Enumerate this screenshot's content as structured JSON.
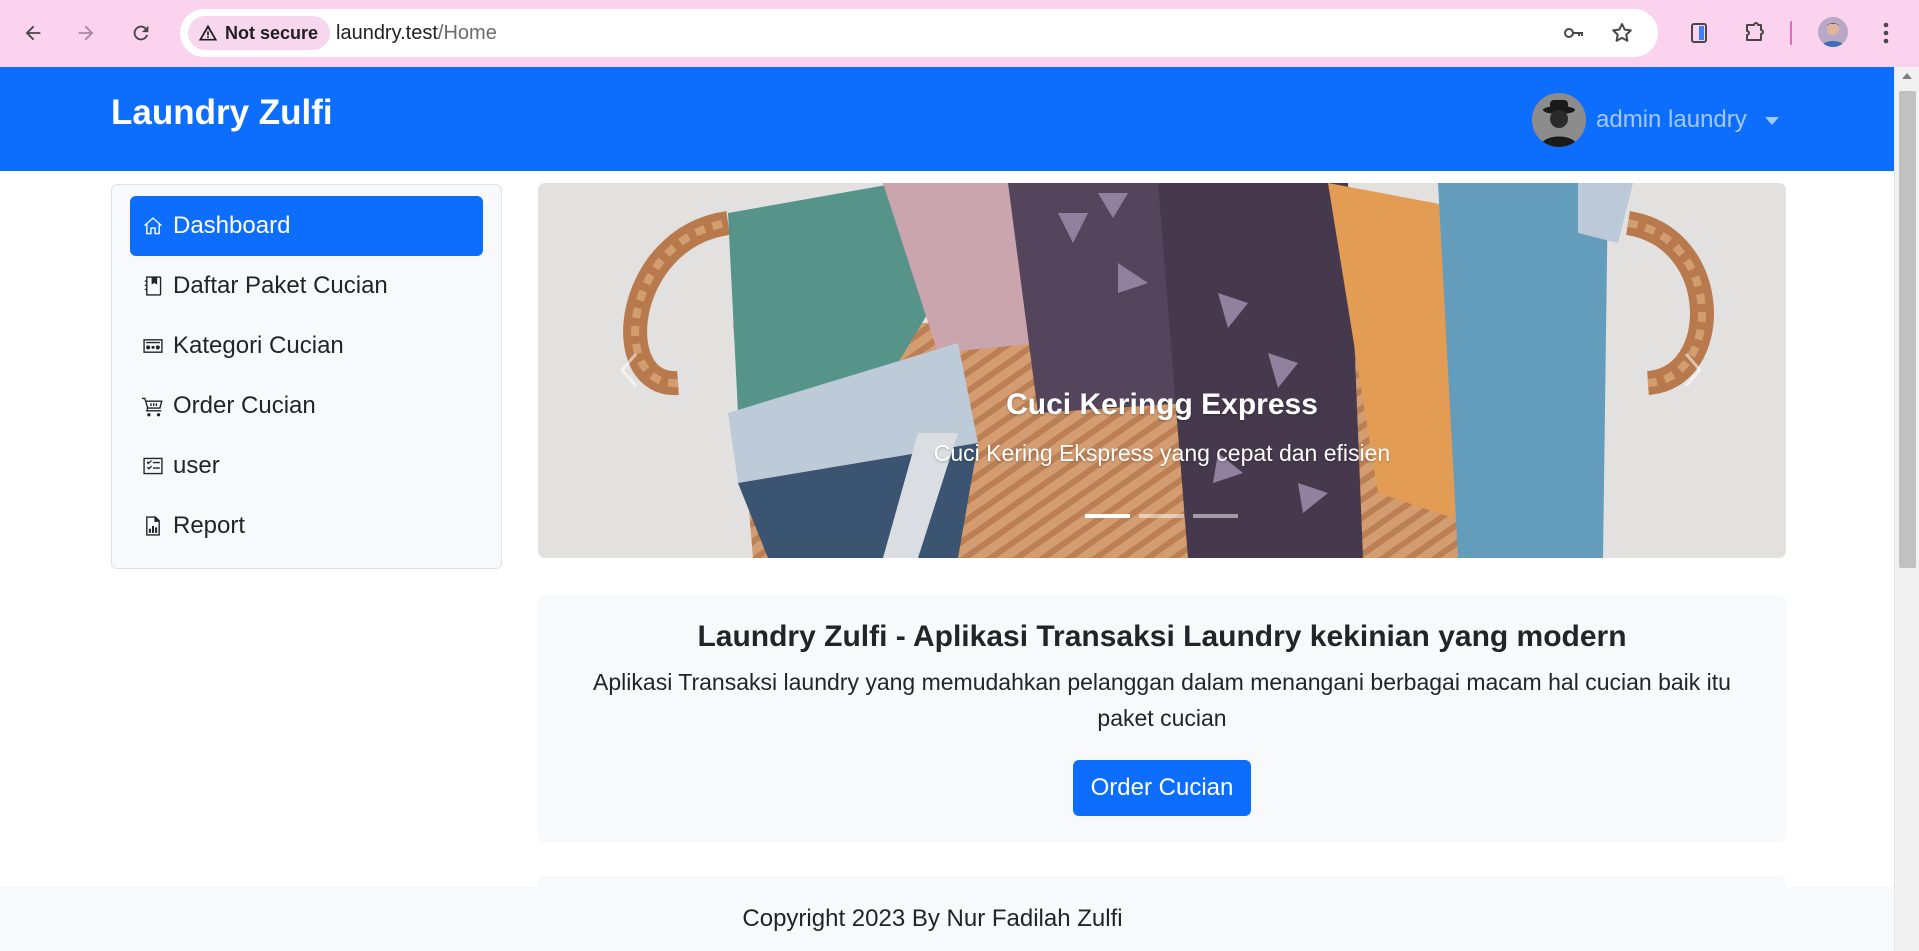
{
  "browser": {
    "security_label": "Not secure",
    "url_host": "laundry.test",
    "url_path": "/Home"
  },
  "navbar": {
    "brand": "Laundry Zulfi",
    "username": "admin laundry"
  },
  "sidebar": {
    "items": [
      {
        "label": "Dashboard",
        "icon": "house-icon",
        "active": true
      },
      {
        "label": "Daftar Paket Cucian",
        "icon": "journal-bookmark-icon",
        "active": false
      },
      {
        "label": "Kategori Cucian",
        "icon": "cassette-icon",
        "active": false
      },
      {
        "label": "Order Cucian",
        "icon": "cart-icon",
        "active": false
      },
      {
        "label": "user",
        "icon": "card-checklist-icon",
        "active": false
      },
      {
        "label": "Report",
        "icon": "file-bar-chart-icon",
        "active": false
      }
    ]
  },
  "carousel": {
    "title": "Cuci Keringg Express",
    "text": "Cuci Kering Ekspress yang cepat dan efisien",
    "slide_count": 3,
    "active_slide": 1
  },
  "hero": {
    "title": "Laundry Zulfi - Aplikasi Transaksi Laundry kekinian yang modern",
    "text": "Aplikasi Transaksi laundry yang memudahkan pelanggan dalam menangani berbagai macam hal cucian baik itu paket cucian",
    "button": "Order Cucian"
  },
  "footer": {
    "text": "Copyright 2023 By Nur Fadilah Zulfi"
  },
  "colors": {
    "primary": "#0d6efd",
    "light": "#f8f9fa",
    "chrome": "#fbd3ee"
  }
}
